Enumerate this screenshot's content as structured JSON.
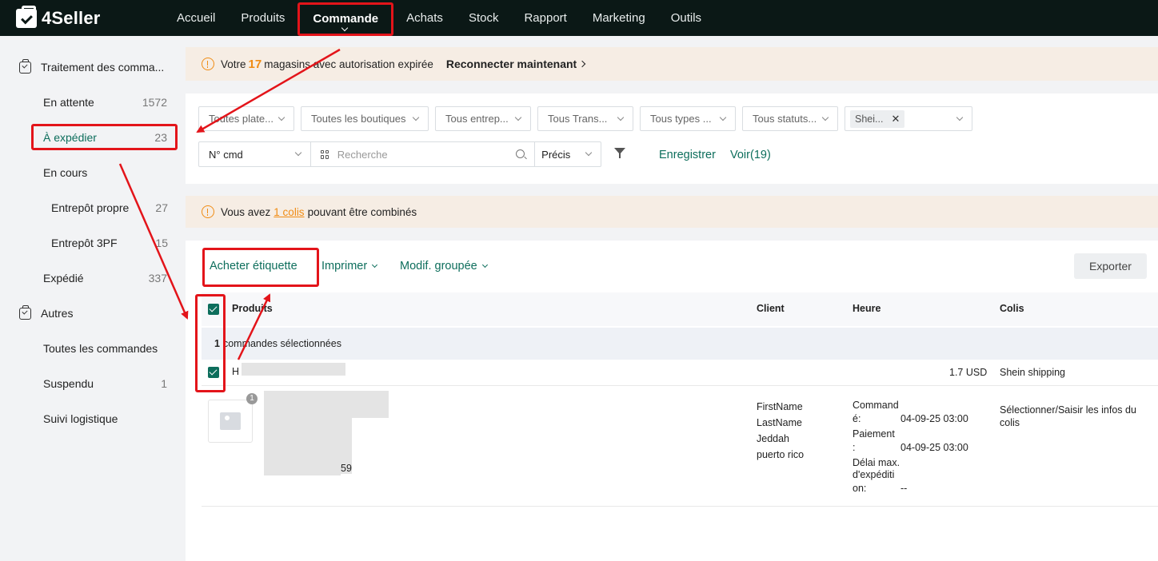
{
  "topbar": {
    "logo": "4Seller",
    "nav": [
      "Accueil",
      "Produits",
      "Commande",
      "Achats",
      "Stock",
      "Rapport",
      "Marketing",
      "Outils"
    ],
    "active": "Commande"
  },
  "sidebar": {
    "group1": "Traitement des comma...",
    "items": [
      {
        "label": "En attente",
        "count": "1572"
      },
      {
        "label": "À expédier",
        "count": "23"
      },
      {
        "label": "En cours",
        "count": ""
      },
      {
        "label": "Entrepôt propre",
        "count": "27"
      },
      {
        "label": "Entrepôt 3PF",
        "count": "15"
      },
      {
        "label": "Expédié",
        "count": "337"
      }
    ],
    "group2": "Autres",
    "items2": [
      {
        "label": "Toutes les commandes",
        "count": ""
      },
      {
        "label": "Suspendu",
        "count": "1"
      },
      {
        "label": "Suivi logistique",
        "count": ""
      }
    ]
  },
  "banner1": {
    "pre": "Votre",
    "count": "17",
    "post": "magasins avec autorisation expirée",
    "action": "Reconnecter maintenant"
  },
  "filters": {
    "selects": [
      "Toutes plate...",
      "Toutes les boutiques",
      "Tous entrep...",
      "Tous Trans...",
      "Tous types ...",
      "Tous statuts..."
    ],
    "tag": "Shei...",
    "search_type": "N° cmd",
    "search_placeholder": "Recherche",
    "search_mode": "Précis",
    "save": "Enregistrer",
    "view": "Voir(19)"
  },
  "banner2": {
    "pre": "Vous avez",
    "link": "1 colis",
    "post": "pouvant être combinés"
  },
  "actions": {
    "buy_label": "Acheter étiquette",
    "print": "Imprimer",
    "bulk_edit": "Modif. groupée",
    "export": "Exporter"
  },
  "table": {
    "headers": {
      "products": "Produits",
      "client": "Client",
      "time": "Heure",
      "parcel": "Colis"
    },
    "selected_count": "1",
    "selected_text": "commandes sélectionnées",
    "order": {
      "id_prefix": "H",
      "amount": "1.7 USD",
      "shipping": "Shein shipping",
      "qty": "1",
      "sku_suffix": "59",
      "client": [
        "FirstName",
        "LastName",
        "Jeddah",
        "puerto rico"
      ],
      "time": {
        "ordered_label_1": "Command",
        "ordered_label_2": "é:",
        "ordered_value": "04-09-25 03:00",
        "paid_label_1": "Paiement",
        "paid_label_2": ":",
        "paid_value": "04-09-25 03:00",
        "deadline_label_1": "Délai max.",
        "deadline_label_2": "d'expéditi",
        "deadline_label_3": "on:",
        "deadline_value": "--"
      },
      "parcel_hint": "Sélectionner/Saisir les infos du colis"
    }
  }
}
